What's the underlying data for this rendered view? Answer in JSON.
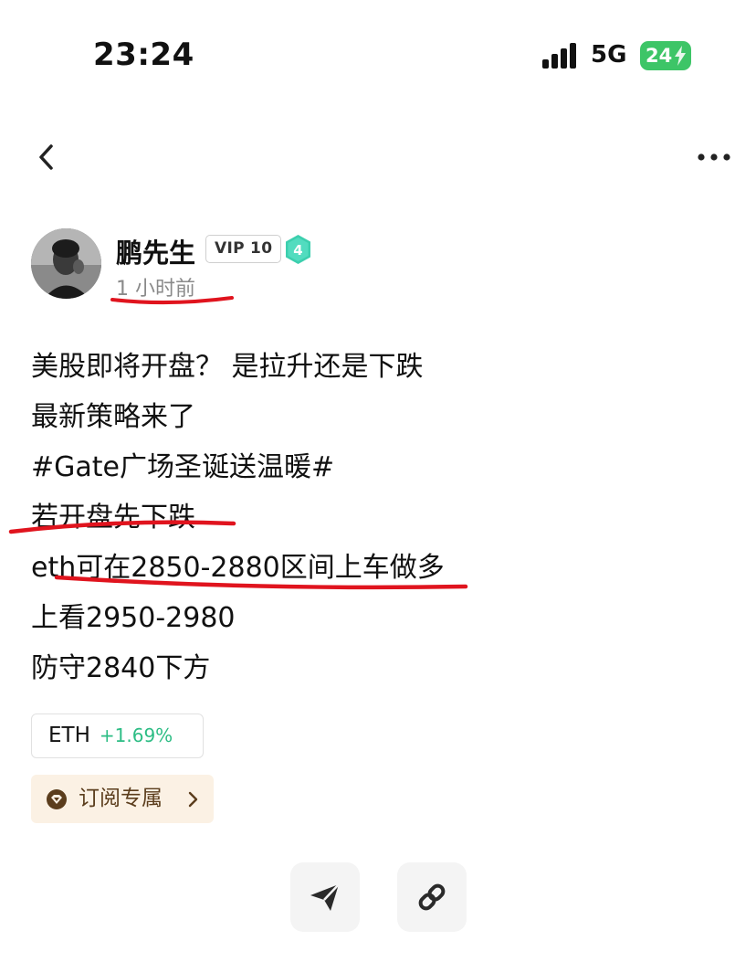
{
  "status_bar": {
    "time": "23:24",
    "network": "5G",
    "battery": "24"
  },
  "author": {
    "name": "鹏先生",
    "vip": "VIP 10",
    "level": "4",
    "posted": "1 小时前"
  },
  "post": {
    "lines": [
      "美股即将开盘？ 是拉升还是下跌",
      "最新策略来了",
      "#Gate广场圣诞送温暖#",
      "若开盘先下跌",
      "eth可在2850-2880区间上车做多",
      "上看2950-2980",
      "防守2840下方"
    ]
  },
  "token": {
    "symbol": "ETH",
    "change": "+1.69%"
  },
  "subscribe": {
    "label": "订阅专属"
  },
  "colors": {
    "positive": "#2dbd85",
    "annotation": "#e0141e",
    "battery": "#3dc567",
    "level_badge": "#3ccfae"
  },
  "icons": [
    "back-icon",
    "more-icon",
    "signal-icon",
    "battery-icon",
    "level-badge-icon",
    "diamond-icon",
    "chevron-right-icon",
    "send-icon",
    "link-icon"
  ]
}
